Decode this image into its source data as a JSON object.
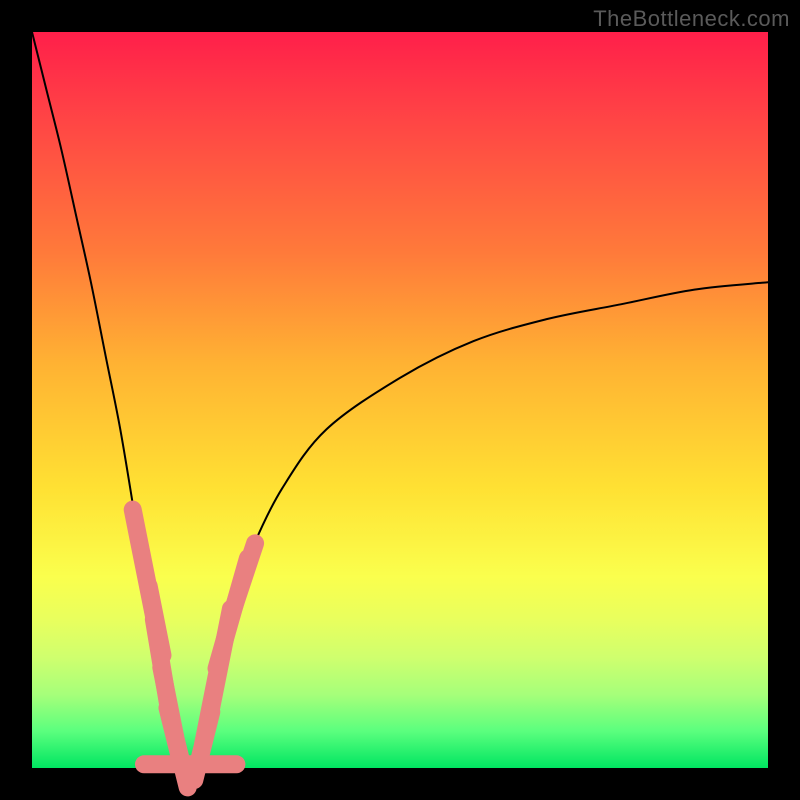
{
  "watermark": {
    "text": "TheBottleneck.com"
  },
  "colors": {
    "frame": "#000000",
    "curve": "#000000",
    "marker_fill": "#e98080",
    "marker_stroke": "#9e4b4b"
  },
  "chart_data": {
    "type": "line",
    "title": "",
    "xlabel": "",
    "ylabel": "",
    "xlim": [
      0,
      100
    ],
    "ylim": [
      0,
      100
    ],
    "grid": false,
    "legend": false,
    "note": "V-shaped bottleneck curve over a vertical red→green heat gradient. Y is a percentage-like cost (lower is better, minimum ≈ 0 near x ≈ 21). Left branch descends from y=100 at x=0; right branch rises asymptotically toward y≈66 at x=100.",
    "series": [
      {
        "name": "bottleneck-curve",
        "x": [
          0,
          2,
          4,
          6,
          8,
          10,
          12,
          14,
          15,
          16,
          17,
          18,
          19,
          20,
          21,
          22,
          23,
          24,
          25,
          26,
          28,
          30,
          34,
          40,
          50,
          60,
          70,
          80,
          90,
          100
        ],
        "y": [
          100,
          92,
          84,
          75,
          66,
          56,
          46,
          34,
          28,
          23,
          18,
          12,
          7,
          3,
          0.5,
          0.5,
          3,
          7,
          12,
          17,
          24,
          30,
          38,
          46,
          53,
          58,
          61,
          63,
          65,
          66
        ]
      }
    ],
    "markers": {
      "name": "highlighted-points",
      "note": "Salmon pill-shaped markers clustered around the valley on both branches.",
      "points": [
        {
          "x": 15.5,
          "y": 26,
          "len": 7
        },
        {
          "x": 16.8,
          "y": 20,
          "len": 4
        },
        {
          "x": 17.6,
          "y": 14,
          "len": 5
        },
        {
          "x": 18.5,
          "y": 9,
          "len": 4
        },
        {
          "x": 19.2,
          "y": 5,
          "len": 3
        },
        {
          "x": 20.0,
          "y": 2,
          "len": 4
        },
        {
          "x": 21.5,
          "y": 0.5,
          "len": 5
        },
        {
          "x": 23.2,
          "y": 3,
          "len": 4
        },
        {
          "x": 24.2,
          "y": 8,
          "len": 4
        },
        {
          "x": 25.5,
          "y": 14,
          "len": 6
        },
        {
          "x": 27.2,
          "y": 21,
          "len": 6
        },
        {
          "x": 28.8,
          "y": 26,
          "len": 4
        }
      ]
    }
  }
}
